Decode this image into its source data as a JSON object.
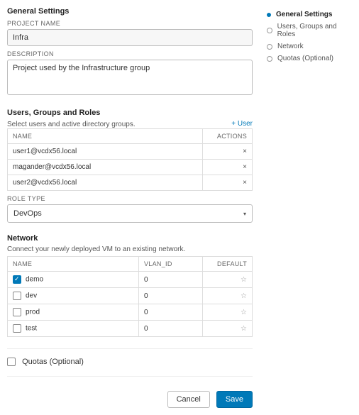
{
  "sidenav": {
    "items": [
      {
        "label": "General Settings",
        "active": true
      },
      {
        "label": "Users, Groups and Roles",
        "active": false
      },
      {
        "label": "Network",
        "active": false
      },
      {
        "label": "Quotas (Optional)",
        "active": false
      }
    ]
  },
  "general": {
    "title": "General Settings",
    "projectNameLabel": "PROJECT NAME",
    "projectName": "Infra",
    "descriptionLabel": "DESCRIPTION",
    "descriptionValue": "Project used by the Infrastructure group"
  },
  "usersSection": {
    "title": "Users, Groups and Roles",
    "subtitle": "Select users and active directory groups.",
    "addLabel": "+  User",
    "headers": {
      "name": "NAME",
      "actions": "ACTIONS"
    },
    "rows": [
      {
        "name": "user1@vcdx56.local"
      },
      {
        "name": "magander@vcdx56.local"
      },
      {
        "name": "user2@vcdx56.local"
      }
    ],
    "roleTypeLabel": "ROLE TYPE",
    "roleTypeValue": "DevOps"
  },
  "networkSection": {
    "title": "Network",
    "subtitle": "Connect your newly deployed VM to an existing network.",
    "headers": {
      "name": "NAME",
      "vlan": "VLAN_ID",
      "def": "DEFAULT"
    },
    "rows": [
      {
        "name": "demo",
        "vlan": "0",
        "checked": true
      },
      {
        "name": "dev",
        "vlan": "0",
        "checked": false
      },
      {
        "name": "prod",
        "vlan": "0",
        "checked": false
      },
      {
        "name": "test",
        "vlan": "0",
        "checked": false
      }
    ]
  },
  "quotas": {
    "label": "Quotas (Optional)"
  },
  "footer": {
    "cancel": "Cancel",
    "save": "Save"
  },
  "glyphs": {
    "x": "×",
    "star": "☆",
    "caret": "▾"
  }
}
